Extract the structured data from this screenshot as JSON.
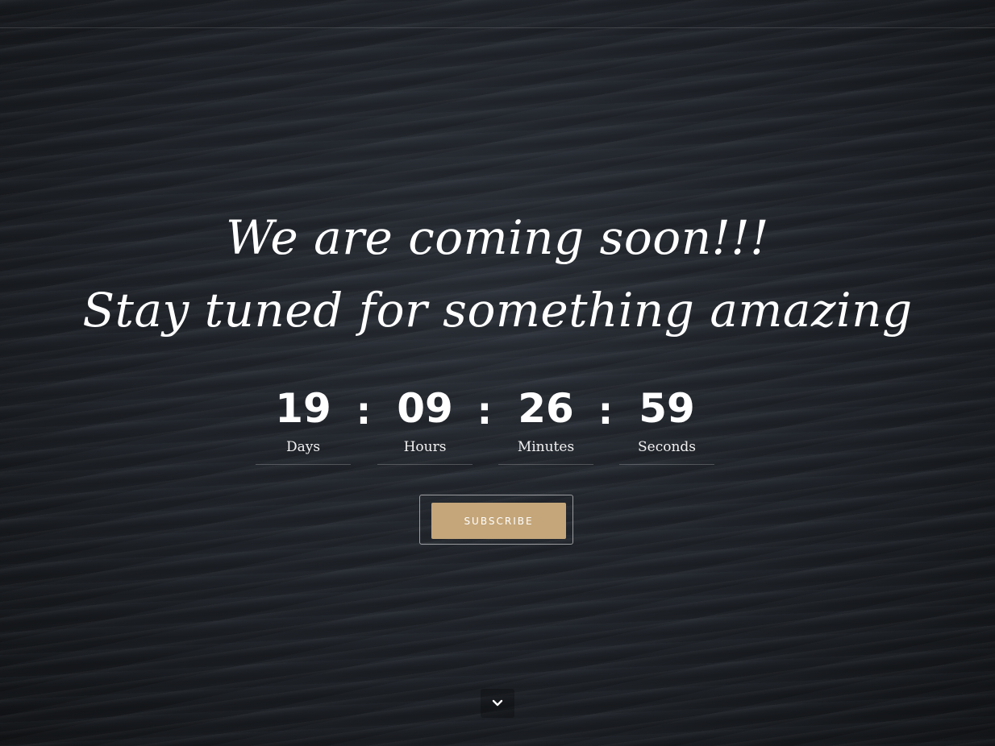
{
  "hero": {
    "line1": "We are coming soon!!!",
    "line2": "Stay tuned for something amazing"
  },
  "countdown": {
    "days": {
      "value": "19",
      "label": "Days"
    },
    "hours": {
      "value": "09",
      "label": "Hours"
    },
    "minutes": {
      "value": "26",
      "label": "Minutes"
    },
    "seconds": {
      "value": "59",
      "label": "Seconds"
    },
    "separator": ":"
  },
  "subscribe": {
    "label": "SUBSCRIBE"
  },
  "scroll": {
    "icon": "chevron-down-icon"
  },
  "colors": {
    "accent": "#c4a67a",
    "text": "#ffffff",
    "background": "#1f2329"
  }
}
